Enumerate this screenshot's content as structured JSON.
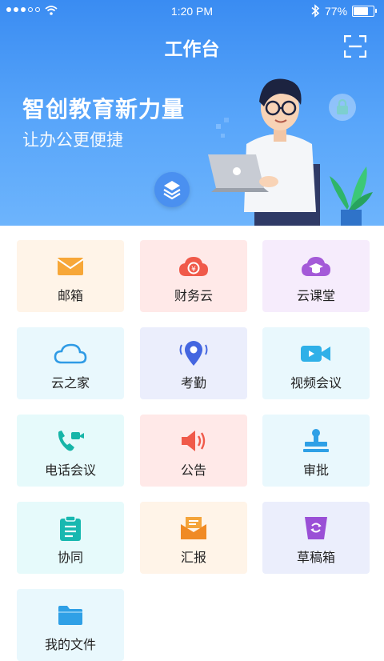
{
  "status_bar": {
    "time": "1:20 PM",
    "battery": "77%",
    "battery_level": 0.77
  },
  "header": {
    "title": "工作台"
  },
  "banner": {
    "headline": "智创教育新力量",
    "subline": "让办公更便捷"
  },
  "colors": {
    "banner_top": "#3a8cf2",
    "banner_bottom": "#6db4fc"
  },
  "apps": [
    {
      "label": "邮箱",
      "icon": "mail-icon"
    },
    {
      "label": "财务云",
      "icon": "finance-cloud-icon"
    },
    {
      "label": "云课堂",
      "icon": "cloud-classroom-icon"
    },
    {
      "label": "云之家",
      "icon": "cloud-icon"
    },
    {
      "label": "考勤",
      "icon": "location-pin-icon"
    },
    {
      "label": "视频会议",
      "icon": "video-camera-icon"
    },
    {
      "label": "电话会议",
      "icon": "phone-video-icon"
    },
    {
      "label": "公告",
      "icon": "speaker-icon"
    },
    {
      "label": "审批",
      "icon": "stamp-icon"
    },
    {
      "label": "协同",
      "icon": "clipboard-icon"
    },
    {
      "label": "汇报",
      "icon": "report-mail-icon"
    },
    {
      "label": "草稿箱",
      "icon": "drafts-bin-icon"
    },
    {
      "label": "我的文件",
      "icon": "folder-icon"
    }
  ]
}
